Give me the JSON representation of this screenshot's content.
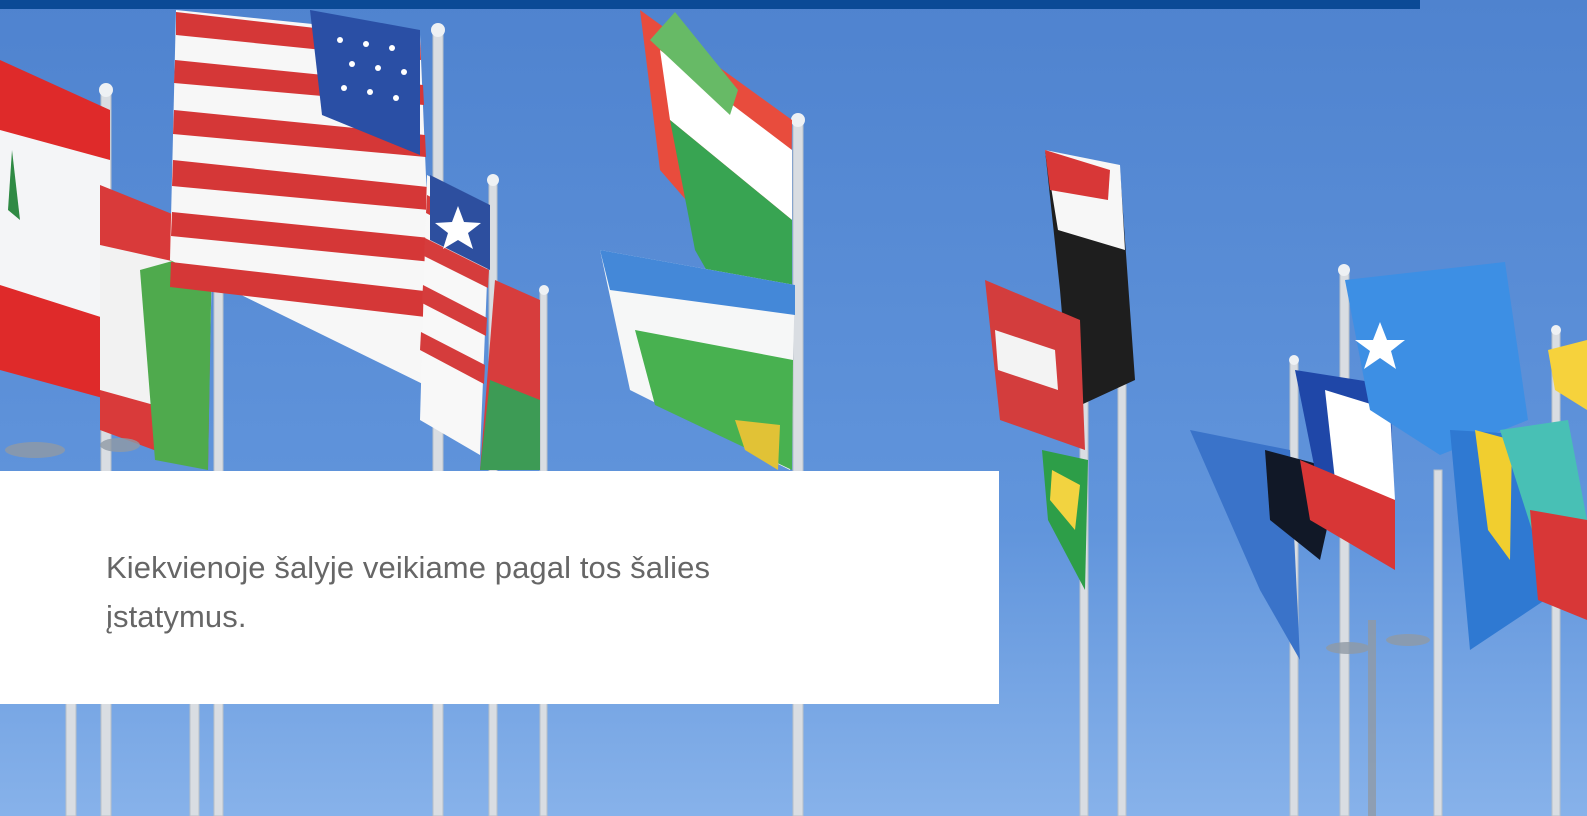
{
  "header": {
    "accent_color": "#0b4a96"
  },
  "hero": {
    "image_subject": "international-flags-photo",
    "sky_color": "#5c8fd6"
  },
  "caption": {
    "text": "Kiekvienoje šalyje veikiame pagal tos šalies įstatymus.",
    "background_color": "#ffffff",
    "text_color": "#666666"
  }
}
